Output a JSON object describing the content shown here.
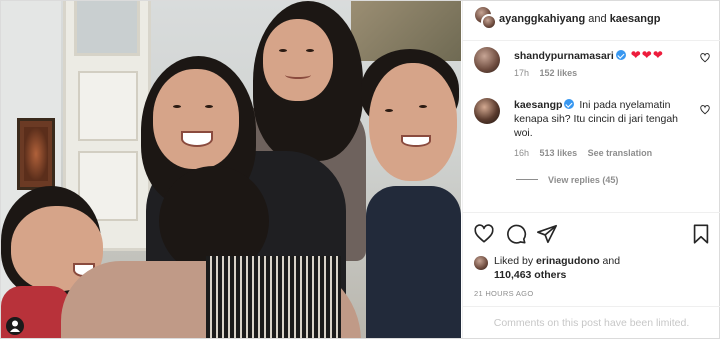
{
  "photo": {
    "alt_icon": "user-silhouette-icon"
  },
  "header": {
    "user1": "ayanggkahiyang",
    "joiner": "and",
    "user2": "kaesangp"
  },
  "comments": [
    {
      "username": "shandypurnamasari",
      "verified": true,
      "text": "❤❤❤",
      "time": "17h",
      "likes": "152 likes",
      "reply_label": "",
      "translate_label": ""
    },
    {
      "username": "kaesangp",
      "verified": true,
      "text": "Ini pada nyelamatin kenapa sih? Itu cincin di jari tengah woi.",
      "time": "16h",
      "likes": "513 likes",
      "translate_label": "See translation"
    }
  ],
  "view_replies": "View replies (45)",
  "actions": {
    "like_icon": "heart-icon",
    "comment_icon": "comment-icon",
    "share_icon": "paper-plane-icon",
    "save_icon": "bookmark-icon"
  },
  "liked_by": {
    "prefix": "Liked by",
    "user": "erinagudono",
    "middle": "and",
    "others": "110,463 others"
  },
  "time_ago": "21 HOURS AGO",
  "comments_limited": "Comments on this post have been limited.",
  "colors": {
    "verified": "#3897f0",
    "heart": "#ed1c3c",
    "meta_gray": "#8e8e8e",
    "border": "#efefef"
  }
}
